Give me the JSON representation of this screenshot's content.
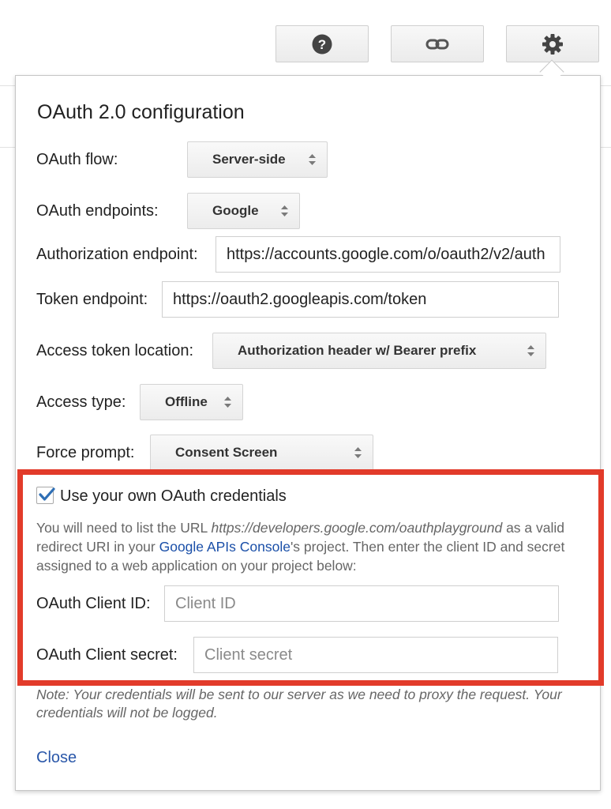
{
  "toolbar": {
    "help_icon": "question-mark-circle",
    "link_icon": "chain-link",
    "settings_icon": "gear"
  },
  "dialog": {
    "title": "OAuth 2.0 configuration",
    "oauth_flow": {
      "label": "OAuth flow:",
      "value": "Server-side"
    },
    "oauth_endpoints": {
      "label": "OAuth endpoints:",
      "value": "Google"
    },
    "authorization_endpoint": {
      "label": "Authorization endpoint:",
      "value": "https://accounts.google.com/o/oauth2/v2/auth"
    },
    "token_endpoint": {
      "label": "Token endpoint:",
      "value": "https://oauth2.googleapis.com/token"
    },
    "access_token_location": {
      "label": "Access token location:",
      "value": "Authorization header w/ Bearer prefix"
    },
    "access_type": {
      "label": "Access type:",
      "value": "Offline"
    },
    "force_prompt": {
      "label": "Force prompt:",
      "value": "Consent Screen"
    },
    "own_credentials": {
      "label": "Use your own OAuth credentials",
      "checked": true,
      "help_prefix": "You will need to list the URL ",
      "help_url": "https://developers.google.com/oauthplayground",
      "help_mid": " as a valid redirect URI in your ",
      "help_link": "Google APIs Console",
      "help_suffix": "'s project. Then enter the client ID and secret assigned to a web application on your project below:",
      "client_id": {
        "label": "OAuth Client ID:",
        "placeholder": "Client ID"
      },
      "client_secret": {
        "label": "OAuth Client secret:",
        "placeholder": "Client secret"
      }
    },
    "note": "Note: Your credentials will be sent to our server as we need to proxy the request. Your credentials will not be logged.",
    "close_label": "Close"
  },
  "colors": {
    "highlight_border": "#e23b2a",
    "link": "#1a4fa8",
    "checkmark": "#2f6fb5"
  }
}
